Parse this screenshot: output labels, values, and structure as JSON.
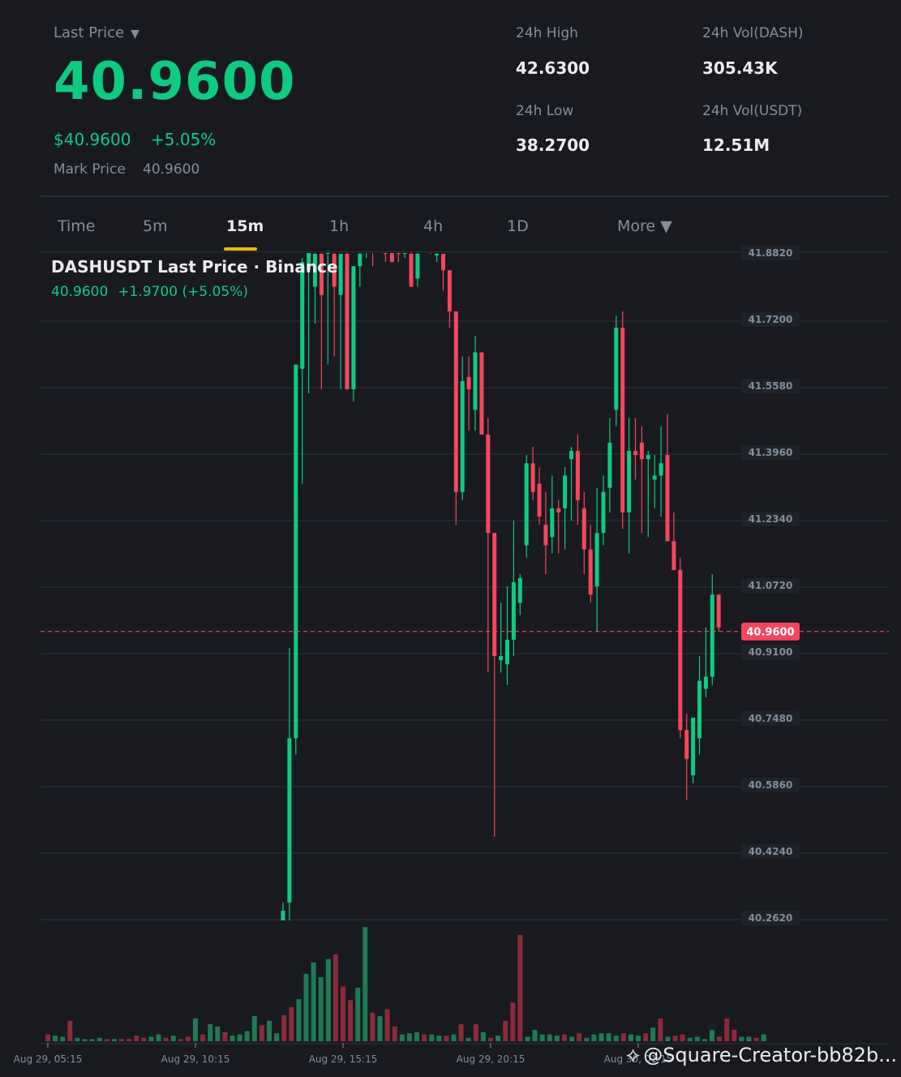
{
  "header": {
    "last_price_label": "Last Price",
    "last_price_caret": "▼",
    "last_price": "40.9600",
    "usd_price": "$40.9600",
    "change_pct": "+5.05%",
    "mark_price_label": "Mark Price",
    "mark_price_value": "40.9600"
  },
  "stats": {
    "high_label": "24h High",
    "high_value": "42.6300",
    "low_label": "24h Low",
    "low_value": "38.2700",
    "vol_base_label": "24h Vol(DASH)",
    "vol_base_value": "305.43K",
    "vol_quote_label": "24h Vol(USDT)",
    "vol_quote_value": "12.51M"
  },
  "tabs": [
    {
      "label": "Time",
      "active": false
    },
    {
      "label": "5m",
      "active": false
    },
    {
      "label": "15m",
      "active": true
    },
    {
      "label": "1h",
      "active": false
    },
    {
      "label": "4h",
      "active": false
    },
    {
      "label": "1D",
      "active": false
    },
    {
      "label": "More ▼",
      "active": false
    }
  ],
  "watermark": {
    "icon": "binance-logo-icon",
    "text": "@Square-Creator-bb82b..."
  },
  "colors": {
    "up": "#0ecb81",
    "down": "#f6465d",
    "up_volume": "#1f7a55",
    "down_volume": "#8a2b3a",
    "grid": "#2b3139",
    "accent": "#f0b90b",
    "background": "#181a20"
  },
  "chart_data": {
    "type": "candlestick",
    "title": "DASHUSDT Last Price · Binance",
    "subtitle_price": "40.9600",
    "subtitle_change": "+1.9700 (+5.05%)",
    "current_price": 40.96,
    "current_price_label": "40.9600",
    "y_ticks": [
      "41.8820",
      "41.7200",
      "41.5580",
      "41.3960",
      "41.2340",
      "41.0720",
      "40.9100",
      "40.7480",
      "40.5860",
      "40.4240",
      "40.2620"
    ],
    "ylim": [
      40.255,
      41.882
    ],
    "x_tick_labels": [
      "Aug 29, 05:15",
      "Aug 29, 10:15",
      "Aug 29, 15:15",
      "Aug 29, 20:15",
      "Aug 30, 01:15"
    ],
    "candles": [
      {
        "o": 40.22,
        "h": 40.3,
        "l": 40.18,
        "c": 40.28
      },
      {
        "o": 40.3,
        "h": 40.92,
        "l": 40.25,
        "c": 40.7
      },
      {
        "o": 40.7,
        "h": 41.5,
        "l": 40.66,
        "c": 41.61
      },
      {
        "o": 41.6,
        "h": 41.87,
        "l": 41.32,
        "c": 41.86
      },
      {
        "o": 41.84,
        "h": 41.9,
        "l": 41.54,
        "c": 41.9
      },
      {
        "o": 41.8,
        "h": 41.91,
        "l": 41.71,
        "c": 41.88
      },
      {
        "o": 41.88,
        "h": 41.91,
        "l": 41.55,
        "c": 41.78
      },
      {
        "o": 41.88,
        "h": 41.91,
        "l": 41.61,
        "c": 41.9
      },
      {
        "o": 41.88,
        "h": 41.91,
        "l": 41.63,
        "c": 41.8
      },
      {
        "o": 41.78,
        "h": 41.88,
        "l": 41.55,
        "c": 41.88
      },
      {
        "o": 41.88,
        "h": 41.92,
        "l": 41.55,
        "c": 41.55
      },
      {
        "o": 41.55,
        "h": 41.85,
        "l": 41.52,
        "c": 41.85
      },
      {
        "o": 41.85,
        "h": 41.92,
        "l": 41.8,
        "c": 41.88
      },
      {
        "o": 41.89,
        "h": 41.91,
        "l": 41.87,
        "c": 41.89
      },
      {
        "o": 41.9,
        "h": 41.92,
        "l": 41.85,
        "c": 41.89
      },
      {
        "o": 41.91,
        "h": 41.92,
        "l": 41.89,
        "c": 41.9
      },
      {
        "o": 41.9,
        "h": 41.92,
        "l": 41.86,
        "c": 41.88
      },
      {
        "o": 41.9,
        "h": 41.92,
        "l": 41.87,
        "c": 41.86
      },
      {
        "o": 41.89,
        "h": 41.91,
        "l": 41.86,
        "c": 41.88
      },
      {
        "o": 41.88,
        "h": 41.91,
        "l": 41.87,
        "c": 41.9
      },
      {
        "o": 41.88,
        "h": 41.92,
        "l": 41.8,
        "c": 41.8
      },
      {
        "o": 41.82,
        "h": 41.91,
        "l": 41.8,
        "c": 41.88
      },
      {
        "o": 41.9,
        "h": 41.92,
        "l": 41.89,
        "c": 41.91
      },
      {
        "o": 41.9,
        "h": 41.92,
        "l": 41.88,
        "c": 41.9
      },
      {
        "o": 41.88,
        "h": 41.91,
        "l": 41.86,
        "c": 41.88
      },
      {
        "o": 41.88,
        "h": 41.88,
        "l": 41.79,
        "c": 41.84
      },
      {
        "o": 41.84,
        "h": 41.74,
        "l": 41.7,
        "c": 41.74
      },
      {
        "o": 41.74,
        "h": 41.7,
        "l": 41.22,
        "c": 41.3
      },
      {
        "o": 41.3,
        "h": 41.63,
        "l": 41.28,
        "c": 41.57
      },
      {
        "o": 41.58,
        "h": 41.63,
        "l": 41.45,
        "c": 41.55
      },
      {
        "o": 41.5,
        "h": 41.68,
        "l": 41.45,
        "c": 41.64
      },
      {
        "o": 41.64,
        "h": 41.64,
        "l": 41.45,
        "c": 41.44
      },
      {
        "o": 41.44,
        "h": 41.48,
        "l": 40.86,
        "c": 41.2
      },
      {
        "o": 41.2,
        "h": 41.2,
        "l": 40.46,
        "c": 40.9
      },
      {
        "o": 40.89,
        "h": 41.03,
        "l": 40.86,
        "c": 40.9
      },
      {
        "o": 40.88,
        "h": 41.07,
        "l": 40.83,
        "c": 40.94
      },
      {
        "o": 40.94,
        "h": 41.23,
        "l": 40.9,
        "c": 41.08
      },
      {
        "o": 41.03,
        "h": 41.1,
        "l": 41.0,
        "c": 41.09
      },
      {
        "o": 41.17,
        "h": 41.39,
        "l": 41.14,
        "c": 41.37
      },
      {
        "o": 41.37,
        "h": 41.41,
        "l": 41.28,
        "c": 41.3
      },
      {
        "o": 41.32,
        "h": 41.36,
        "l": 41.22,
        "c": 41.24
      },
      {
        "o": 41.22,
        "h": 41.3,
        "l": 41.1,
        "c": 41.17
      },
      {
        "o": 41.19,
        "h": 41.34,
        "l": 41.15,
        "c": 41.26
      },
      {
        "o": 41.26,
        "h": 41.28,
        "l": 41.15,
        "c": 41.25
      },
      {
        "o": 41.26,
        "h": 41.36,
        "l": 41.16,
        "c": 41.34
      },
      {
        "o": 41.38,
        "h": 41.41,
        "l": 41.23,
        "c": 41.4
      },
      {
        "o": 41.4,
        "h": 41.44,
        "l": 41.22,
        "c": 41.28
      },
      {
        "o": 41.26,
        "h": 41.3,
        "l": 41.1,
        "c": 41.16
      },
      {
        "o": 41.16,
        "h": 41.22,
        "l": 41.03,
        "c": 41.05
      },
      {
        "o": 41.07,
        "h": 41.31,
        "l": 40.96,
        "c": 41.2
      },
      {
        "o": 41.2,
        "h": 41.34,
        "l": 41.17,
        "c": 41.3
      },
      {
        "o": 41.31,
        "h": 41.48,
        "l": 41.25,
        "c": 41.42
      },
      {
        "o": 41.5,
        "h": 41.73,
        "l": 41.46,
        "c": 41.7
      },
      {
        "o": 41.7,
        "h": 41.74,
        "l": 41.21,
        "c": 41.25
      },
      {
        "o": 41.25,
        "h": 41.48,
        "l": 41.15,
        "c": 41.4
      },
      {
        "o": 41.4,
        "h": 41.48,
        "l": 41.33,
        "c": 41.39
      },
      {
        "o": 41.42,
        "h": 41.46,
        "l": 41.2,
        "c": 41.38
      },
      {
        "o": 41.38,
        "h": 41.4,
        "l": 41.19,
        "c": 41.39
      },
      {
        "o": 41.33,
        "h": 41.39,
        "l": 41.26,
        "c": 41.34
      },
      {
        "o": 41.34,
        "h": 41.46,
        "l": 41.24,
        "c": 41.37
      },
      {
        "o": 41.39,
        "h": 41.49,
        "l": 41.22,
        "c": 41.18
      },
      {
        "o": 41.18,
        "h": 41.25,
        "l": 41.14,
        "c": 41.11
      },
      {
        "o": 41.11,
        "h": 41.14,
        "l": 40.7,
        "c": 40.72
      },
      {
        "o": 40.72,
        "h": 40.76,
        "l": 40.55,
        "c": 40.65
      },
      {
        "o": 40.61,
        "h": 40.75,
        "l": 40.59,
        "c": 40.75
      },
      {
        "o": 40.7,
        "h": 40.9,
        "l": 40.66,
        "c": 40.84
      },
      {
        "o": 40.82,
        "h": 40.97,
        "l": 40.8,
        "c": 40.85
      },
      {
        "o": 40.85,
        "h": 41.1,
        "l": 40.83,
        "c": 41.05
      },
      {
        "o": 41.05,
        "h": 41.05,
        "l": 40.96,
        "c": 40.97
      }
    ],
    "volumes": [
      {
        "v": 0.06,
        "d": "down"
      },
      {
        "v": 0.05,
        "d": "up"
      },
      {
        "v": 0.04,
        "d": "up"
      },
      {
        "v": 0.18,
        "d": "down"
      },
      {
        "v": 0.03,
        "d": "up"
      },
      {
        "v": 0.02,
        "d": "up"
      },
      {
        "v": 0.02,
        "d": "up"
      },
      {
        "v": 0.03,
        "d": "up"
      },
      {
        "v": 0.02,
        "d": "down"
      },
      {
        "v": 0.02,
        "d": "up"
      },
      {
        "v": 0.02,
        "d": "down"
      },
      {
        "v": 0.02,
        "d": "down"
      },
      {
        "v": 0.05,
        "d": "down"
      },
      {
        "v": 0.03,
        "d": "down"
      },
      {
        "v": 0.04,
        "d": "up"
      },
      {
        "v": 0.06,
        "d": "up"
      },
      {
        "v": 0.03,
        "d": "down"
      },
      {
        "v": 0.05,
        "d": "up"
      },
      {
        "v": 0.02,
        "d": "down"
      },
      {
        "v": 0.04,
        "d": "down"
      },
      {
        "v": 0.2,
        "d": "up"
      },
      {
        "v": 0.06,
        "d": "down"
      },
      {
        "v": 0.15,
        "d": "up"
      },
      {
        "v": 0.13,
        "d": "up"
      },
      {
        "v": 0.08,
        "d": "down"
      },
      {
        "v": 0.05,
        "d": "up"
      },
      {
        "v": 0.06,
        "d": "up"
      },
      {
        "v": 0.09,
        "d": "up"
      },
      {
        "v": 0.22,
        "d": "up"
      },
      {
        "v": 0.14,
        "d": "down"
      },
      {
        "v": 0.18,
        "d": "up"
      },
      {
        "v": 0.07,
        "d": "up"
      },
      {
        "v": 0.23,
        "d": "down"
      },
      {
        "v": 0.3,
        "d": "down"
      },
      {
        "v": 0.37,
        "d": "up"
      },
      {
        "v": 0.59,
        "d": "up"
      },
      {
        "v": 0.69,
        "d": "up"
      },
      {
        "v": 0.56,
        "d": "up"
      },
      {
        "v": 0.72,
        "d": "up"
      },
      {
        "v": 0.76,
        "d": "down"
      },
      {
        "v": 0.48,
        "d": "down"
      },
      {
        "v": 0.36,
        "d": "down"
      },
      {
        "v": 0.47,
        "d": "up"
      },
      {
        "v": 1.0,
        "d": "up"
      },
      {
        "v": 0.25,
        "d": "down"
      },
      {
        "v": 0.22,
        "d": "up"
      },
      {
        "v": 0.28,
        "d": "down"
      },
      {
        "v": 0.13,
        "d": "down"
      },
      {
        "v": 0.06,
        "d": "up"
      },
      {
        "v": 0.07,
        "d": "up"
      },
      {
        "v": 0.08,
        "d": "up"
      },
      {
        "v": 0.06,
        "d": "down"
      },
      {
        "v": 0.06,
        "d": "up"
      },
      {
        "v": 0.05,
        "d": "up"
      },
      {
        "v": 0.05,
        "d": "down"
      },
      {
        "v": 0.06,
        "d": "up"
      },
      {
        "v": 0.15,
        "d": "down"
      },
      {
        "v": 0.03,
        "d": "up"
      },
      {
        "v": 0.15,
        "d": "down"
      },
      {
        "v": 0.08,
        "d": "up"
      },
      {
        "v": 0.03,
        "d": "down"
      },
      {
        "v": 0.05,
        "d": "up"
      },
      {
        "v": 0.18,
        "d": "down"
      },
      {
        "v": 0.34,
        "d": "down"
      },
      {
        "v": 0.93,
        "d": "down"
      },
      {
        "v": 0.04,
        "d": "up"
      },
      {
        "v": 0.1,
        "d": "up"
      },
      {
        "v": 0.06,
        "d": "up"
      },
      {
        "v": 0.06,
        "d": "up"
      },
      {
        "v": 0.05,
        "d": "up"
      },
      {
        "v": 0.06,
        "d": "down"
      },
      {
        "v": 0.04,
        "d": "up"
      },
      {
        "v": 0.07,
        "d": "down"
      },
      {
        "v": 0.03,
        "d": "up"
      },
      {
        "v": 0.06,
        "d": "up"
      },
      {
        "v": 0.07,
        "d": "up"
      },
      {
        "v": 0.07,
        "d": "up"
      },
      {
        "v": 0.05,
        "d": "up"
      },
      {
        "v": 0.07,
        "d": "down"
      },
      {
        "v": 0.06,
        "d": "up"
      },
      {
        "v": 0.05,
        "d": "up"
      },
      {
        "v": 0.07,
        "d": "down"
      },
      {
        "v": 0.12,
        "d": "up"
      },
      {
        "v": 0.2,
        "d": "down"
      },
      {
        "v": 0.04,
        "d": "up"
      },
      {
        "v": 0.05,
        "d": "down"
      },
      {
        "v": 0.06,
        "d": "down"
      },
      {
        "v": 0.03,
        "d": "up"
      },
      {
        "v": 0.04,
        "d": "up"
      },
      {
        "v": 0.02,
        "d": "up"
      },
      {
        "v": 0.1,
        "d": "up"
      },
      {
        "v": 0.04,
        "d": "down"
      },
      {
        "v": 0.2,
        "d": "down"
      },
      {
        "v": 0.1,
        "d": "down"
      },
      {
        "v": 0.04,
        "d": "up"
      },
      {
        "v": 0.04,
        "d": "up"
      },
      {
        "v": 0.03,
        "d": "down"
      },
      {
        "v": 0.06,
        "d": "up"
      }
    ]
  }
}
